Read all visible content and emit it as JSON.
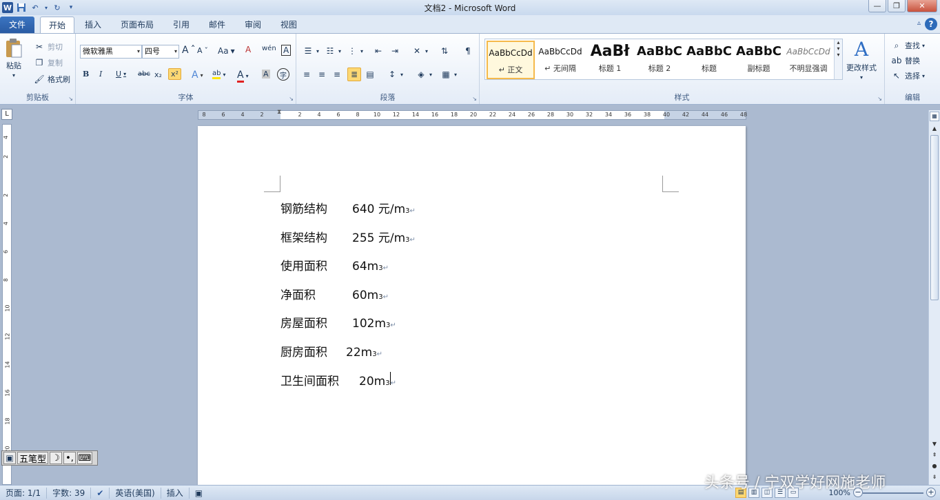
{
  "window": {
    "title": "文档2 - Microsoft Word",
    "app_icon": "W",
    "controls": {
      "minimize": "—",
      "restore": "❐",
      "close": "✕"
    }
  },
  "tabs": [
    {
      "label": "文件"
    },
    {
      "label": "开始"
    },
    {
      "label": "插入"
    },
    {
      "label": "页面布局"
    },
    {
      "label": "引用"
    },
    {
      "label": "邮件"
    },
    {
      "label": "审阅"
    },
    {
      "label": "视图"
    }
  ],
  "ribbon": {
    "clipboard": {
      "label": "剪贴板",
      "paste": "粘贴",
      "cut": "剪切",
      "copy": "复制",
      "format_painter": "格式刷"
    },
    "font": {
      "label": "字体",
      "font_name": "微软雅黑",
      "font_size": "四号",
      "grow": "A",
      "shrink": "A",
      "case": "Aa",
      "clear": "A",
      "phonetic": "wén",
      "border": "A",
      "bold": "B",
      "italic": "I",
      "underline": "U",
      "strike": "abc",
      "subscript": "x₂",
      "superscript": "x²",
      "effects": "A",
      "highlight": "ab",
      "color": "A",
      "shading": "A",
      "enclose": "字"
    },
    "paragraph": {
      "label": "段落"
    },
    "styles": {
      "label": "样式",
      "items": [
        {
          "sample": "AaBbCcDd",
          "name": "↵ 正文"
        },
        {
          "sample": "AaBbCcDd",
          "name": "↵ 无间隔"
        },
        {
          "sample": "AaBł",
          "name": "标题 1"
        },
        {
          "sample": "AaBbC",
          "name": "标题 2"
        },
        {
          "sample": "AaBbC",
          "name": "标题"
        },
        {
          "sample": "AaBbC",
          "name": "副标题"
        },
        {
          "sample": "AaBbCcDd",
          "name": "不明显强调"
        }
      ],
      "change_styles": "更改样式"
    },
    "editing": {
      "label": "编辑",
      "find": "查找",
      "replace": "替换",
      "select": "选择"
    }
  },
  "ruler": {
    "h_numbers": [
      "8",
      "6",
      "4",
      "2",
      "2",
      "4",
      "6",
      "8",
      "10",
      "12",
      "14",
      "16",
      "18",
      "20",
      "22",
      "24",
      "26",
      "28",
      "30",
      "32",
      "34",
      "36",
      "38",
      "40",
      "42",
      "44",
      "46",
      "48"
    ],
    "v_numbers": [
      "4",
      "2",
      "2",
      "4",
      "6",
      "8",
      "10",
      "12",
      "14",
      "16",
      "18",
      "20"
    ],
    "corner": "L"
  },
  "document": {
    "lines": [
      {
        "label": "钢筋结构",
        "gap": "    ",
        "value": "640 元/m",
        "sup": "3"
      },
      {
        "label": "框架结构",
        "gap": "    ",
        "value": "255 元/m",
        "sup": "3"
      },
      {
        "label": "使用面积",
        "gap": "    ",
        "value": "64m",
        "sup": "3"
      },
      {
        "label": "净面积",
        "gap": "      ",
        "value": "60m",
        "sup": "3"
      },
      {
        "label": "房屋面积",
        "gap": "    ",
        "value": "102m",
        "sup": "3"
      },
      {
        "label": "厨房面积",
        "gap": "  ",
        "value": "22m",
        "sup": "3"
      },
      {
        "label": "卫生间面积",
        "gap": "  ",
        "value": "20m",
        "sup": "3"
      }
    ],
    "para_mark": "↵"
  },
  "ime": {
    "name": "五笔型",
    "icon1": "☽",
    "icon2": "•,",
    "icon3": "⌨"
  },
  "status": {
    "page": "页面: 1/1",
    "words": "字数: 39",
    "language": "英语(美国)",
    "mode": "插入",
    "zoom": "100%"
  },
  "watermark": "头条号 / 宁双学好网施老师"
}
